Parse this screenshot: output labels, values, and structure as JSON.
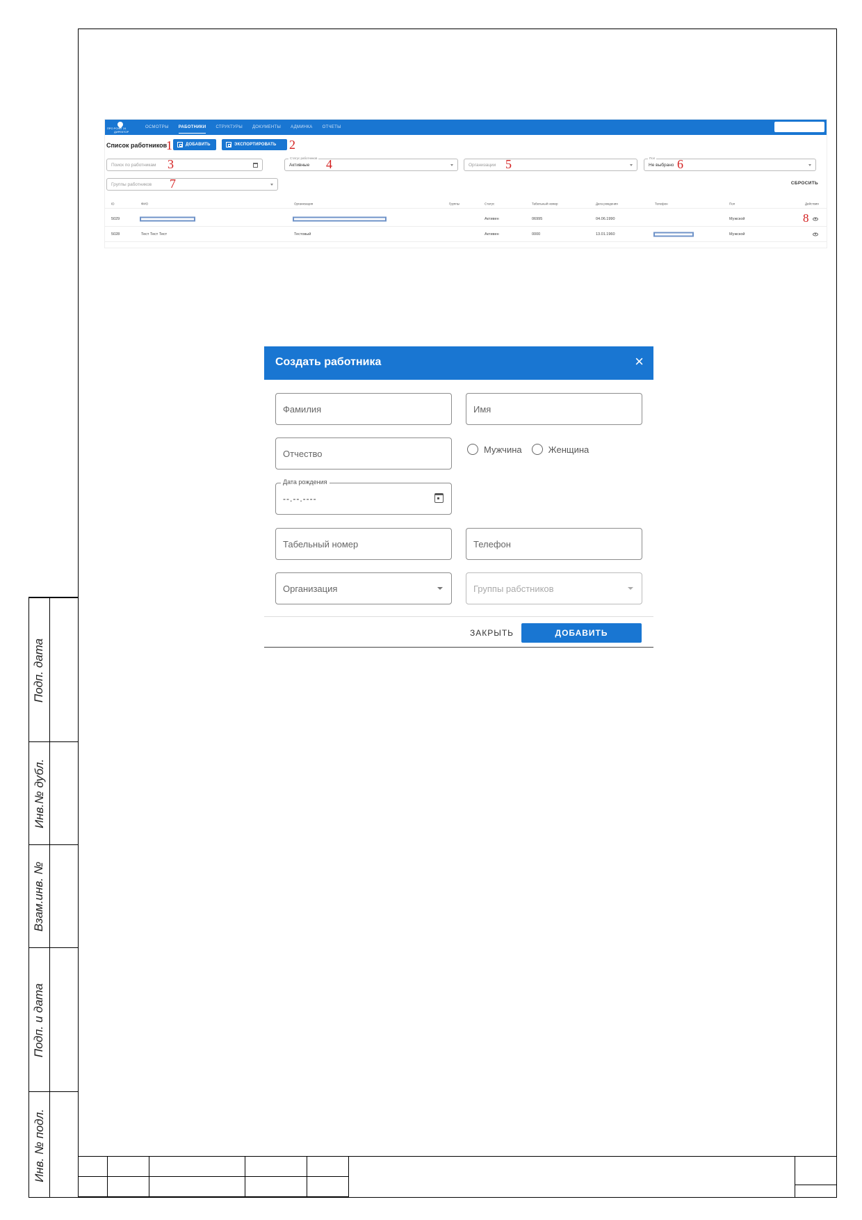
{
  "side_stamp": {
    "labels": [
      "Инв. № подл.",
      "Подп. и дата",
      "Взам.инв. №",
      "Инв.№ дубл.",
      "Подп. дата"
    ]
  },
  "app": {
    "logo": {
      "line1": "ПРО POINT 24",
      "line2": "ДИРЕКТОР"
    },
    "nav": [
      {
        "label": "ОСМОТРЫ",
        "active": false
      },
      {
        "label": "РАБОТНИКИ",
        "active": true
      },
      {
        "label": "СТРУКТУРЫ",
        "active": false
      },
      {
        "label": "ДОКУМЕНТЫ",
        "active": false
      },
      {
        "label": "АДМИНКА",
        "active": false
      },
      {
        "label": "ОТЧЕТЫ",
        "active": false
      }
    ],
    "colors": {
      "primary": "#1976d2",
      "callout": "#d31f1f"
    },
    "list_title": "Список работников",
    "add_button": "ДОБАВИТЬ",
    "export_button": "ЭКСПОРТИРОВАТЬ",
    "filters": {
      "search_placeholder": "Поиск по работникам",
      "status_label": "Статус работников",
      "status_value": "Активные",
      "organizations_placeholder": "Организации",
      "gender_label": "Пол",
      "gender_value": "Не выбрано",
      "groups_placeholder": "Группы работников",
      "reset": "СБРОСИТЬ"
    },
    "callouts": [
      "1",
      "2",
      "3",
      "4",
      "5",
      "6",
      "7",
      "8"
    ],
    "table": {
      "columns": [
        "ID",
        "ФИО",
        "Организация",
        "Группы",
        "Статус",
        "Табельный номер",
        "Дата рождения",
        "Телефон",
        "Пол",
        "Действия"
      ],
      "rows": [
        {
          "id": "5029",
          "fio": "",
          "org": "",
          "groups": "",
          "status": "Активен",
          "tab_no": "06995",
          "birth": "04.06.1990",
          "phone": "",
          "gender": "Мужской"
        },
        {
          "id": "5028",
          "fio": "Тест Тест Тест",
          "org": "Тестовый",
          "groups": "",
          "status": "Активен",
          "tab_no": "0000",
          "birth": "13.01.1960",
          "phone": "",
          "gender": "Мужской"
        }
      ]
    }
  },
  "dialog": {
    "title": "Создать работника",
    "close_icon": "×",
    "fields": {
      "last_name": "Фамилия",
      "first_name": "Имя",
      "middle_name": "Отчество",
      "gender_male": "Мужчина",
      "gender_female": "Женщина",
      "birth_label": "Дата рождения",
      "birth_value": "--.--.----",
      "tab_number": "Табельный номер",
      "phone": "Телефон",
      "organization": "Организация",
      "groups": "Группы рабстников"
    },
    "close_button": "ЗАКРЫТЬ",
    "add_button": "ДОБАВИТЬ"
  }
}
